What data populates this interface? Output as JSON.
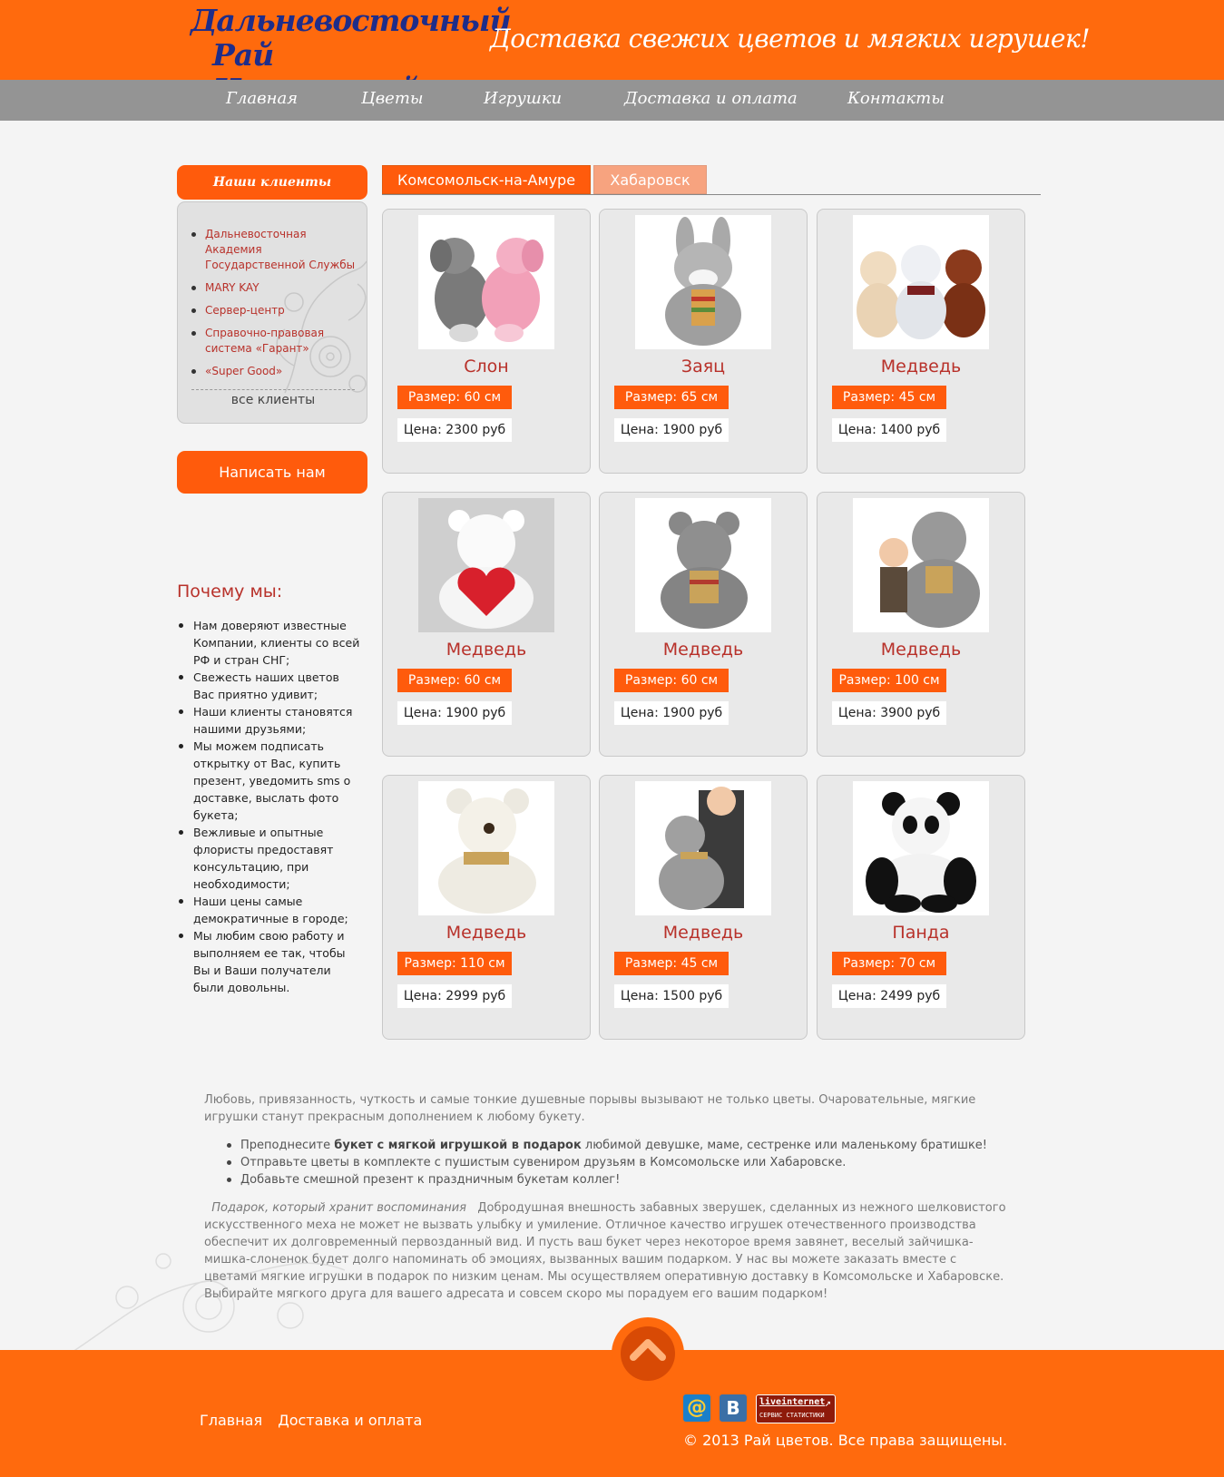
{
  "header": {
    "logo_line1": "Дальневосточный",
    "logo_line2": "Рай Цветочный",
    "slogan": "Доставка свежих цветов и мягких игрушек!"
  },
  "nav": {
    "items": [
      "Главная",
      "Цветы",
      "Игрушки",
      "Доставка и оплата",
      "Контакты"
    ]
  },
  "sidebar": {
    "clients_title": "Наши клиенты",
    "clients": [
      "Дальневосточная Академия Государственной Службы",
      "MARY KAY",
      "Сервер-центр",
      "Справочно-правовая система «Гарант»",
      "«Super Good»"
    ],
    "all_clients": "все клиенты",
    "write_button": "Написать нам",
    "why_title": "Почему мы:",
    "why_items": [
      "Нам доверяют известные Компании, клиенты со всей РФ и стран СНГ;",
      "Свежесть наших цветов Вас приятно удивит;",
      "Наши клиенты становятся нашими друзьями;",
      "Мы можем подписать открытку от Вас, купить презент, уведомить sms о доставке, выслать фото букета;",
      "Вежливые и опытные флористы предоставят консультацию, при необходимости;",
      "Наши цены самые демократичные в городе;",
      "Мы любим свою работу и выполняем ее так, чтобы Вы и Ваши получатели были довольны."
    ]
  },
  "tabs": {
    "active": "Комсомольск-на-Амуре",
    "inactive": "Хабаровск"
  },
  "products": [
    {
      "name": "Слон",
      "size": "Размер: 60 см",
      "price": "Цена: 2300 руб",
      "icon": "elephant-toy-photo"
    },
    {
      "name": "Заяц",
      "size": "Размер: 65 см",
      "price": "Цена: 1900 руб",
      "icon": "hare-toy-photo"
    },
    {
      "name": "Медведь",
      "size": "Размер: 45 см",
      "price": "Цена: 1400 руб",
      "icon": "bears-toy-photo"
    },
    {
      "name": "Медведь",
      "size": "Размер: 60 см",
      "price": "Цена: 1900 руб",
      "icon": "white-bear-heart-photo"
    },
    {
      "name": "Медведь",
      "size": "Размер: 60 см",
      "price": "Цена: 1900 руб",
      "icon": "grey-bear-photo"
    },
    {
      "name": "Медведь",
      "size": "Размер: 100 см",
      "price": "Цена: 3900 руб",
      "icon": "bear-with-child-photo"
    },
    {
      "name": "Медведь",
      "size": "Размер: 110 см",
      "price": "Цена: 2999 руб",
      "icon": "white-bear-photo"
    },
    {
      "name": "Медведь",
      "size": "Размер: 45 см",
      "price": "Цена: 1500 руб",
      "icon": "girl-with-bear-photo"
    },
    {
      "name": "Панда",
      "size": "Размер: 70 см",
      "price": "Цена: 2499 руб",
      "icon": "panda-toy-photo"
    }
  ],
  "seo": {
    "intro": "Любовь, привязанность, чуткость и самые тонкие душевные порывы вызывают не только цветы. Очаровательные, мягкие игрушки станут прекрасным дополнением к любому букету.",
    "bullet1_pre": "Преподнесите ",
    "bullet1_bold": "букет с мягкой игрушкой в подарок",
    "bullet1_post": " любимой девушке, маме, сестренке или маленькому братишке!",
    "bullet2": "Отправьте цветы в комплекте с пушистым сувениром друзьям в Комсомольске или Хабаровске.",
    "bullet3": "Добавьте смешной презент к праздничным букетам коллег!",
    "lead": "Подарок, который хранит воспоминания",
    "body": "Добродушная внешность забавных зверушек, сделанных из нежного шелковистого искусственного меха не может не вызвать улыбку и умиление. Отличное качество игрушек отечественного производства обеспечит их долговременный первозданный вид. И пусть ваш букет через некоторое время завянет, веселый зайчишка-мишка-слоненок будет долго напоминать об эмоциях, вызванных вашим подарком.   У нас вы можете заказать вместе с цветами мягкие игрушки в подарок по низким ценам. Мы осуществляем оперативную доставку в Комсомольске и Хабаровске. Выбирайте мягкого друга для вашего адресата и совсем скоро мы порадуем его вашим подарком!"
  },
  "footer": {
    "links": [
      "Главная",
      "Доставка и оплата"
    ],
    "mail_icon": "@",
    "vk_icon": "B",
    "li_line1": "liveinternet",
    "li_line2": "СЕРВИС СТАТИСТИКИ",
    "copyright": "© 2013 Рай цветов. Все права защищены."
  },
  "colors": {
    "accent": "#ff6a0d",
    "nav": "#949494",
    "product_name": "#b8312a"
  }
}
